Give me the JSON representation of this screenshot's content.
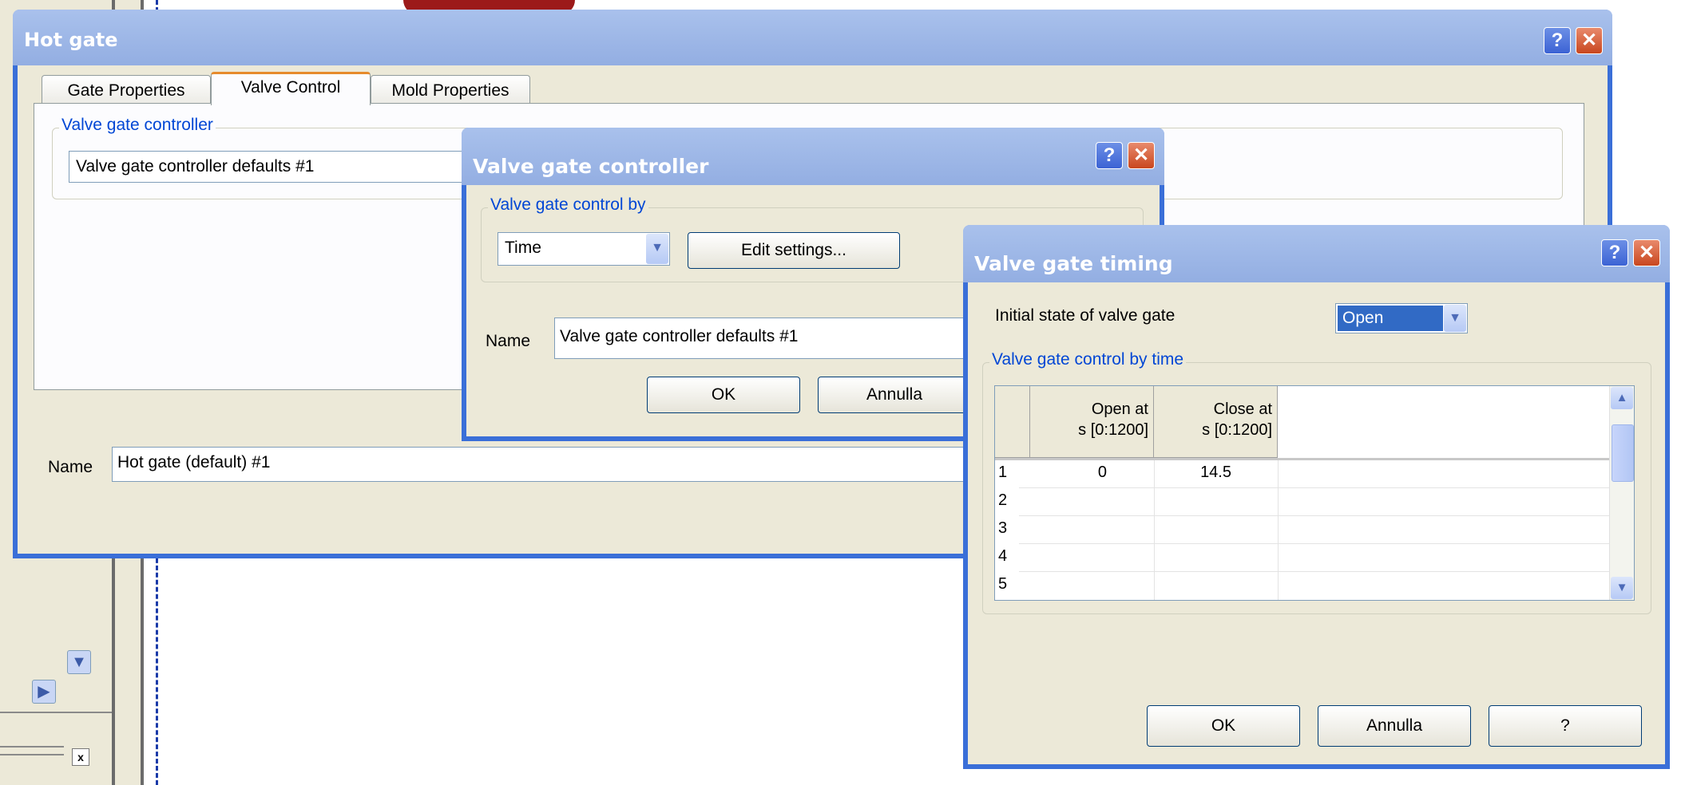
{
  "hot_gate": {
    "title": "Hot gate",
    "tabs": [
      "Gate Properties",
      "Valve Control",
      "Mold Properties"
    ],
    "group_label": "Valve gate controller",
    "controller_value": "Valve gate controller defaults #1",
    "name_label": "Name",
    "name_value": "Hot gate (default) #1"
  },
  "valve_gate_controller": {
    "title": "Valve gate controller",
    "group_label": "Valve gate control by",
    "control_by_value": "Time",
    "edit_settings_label": "Edit settings...",
    "name_label": "Name",
    "name_value": "Valve gate controller defaults #1",
    "ok_label": "OK",
    "cancel_label": "Annulla"
  },
  "valve_gate_timing": {
    "title": "Valve gate timing",
    "initial_state_label": "Initial state of valve gate",
    "initial_state_value": "Open",
    "group_label": "Valve gate control by time",
    "columns": [
      {
        "line1": "Open at",
        "line2": "s [0:1200]"
      },
      {
        "line1": "Close at",
        "line2": "s [0:1200]"
      }
    ],
    "rows": [
      {
        "num": "1",
        "open": "0",
        "close": "14.5"
      },
      {
        "num": "2",
        "open": "",
        "close": ""
      },
      {
        "num": "3",
        "open": "",
        "close": ""
      },
      {
        "num": "4",
        "open": "",
        "close": ""
      },
      {
        "num": "5",
        "open": "",
        "close": ""
      }
    ],
    "ok_label": "OK",
    "cancel_label": "Annulla",
    "help_label": "?"
  },
  "title_buttons": {
    "help": "?",
    "close": "✕"
  },
  "icons": {
    "dropdown": "▼",
    "scroll_up": "▲",
    "scroll_down": "▼",
    "scroll_right": "▶",
    "close_small": "x"
  },
  "colors": {
    "xp_blue": "#3a6fd8",
    "legend_blue": "#0046d5",
    "face": "#ece9d8",
    "tab_highlight": "#e68b2c",
    "close_red": "#c9471f"
  }
}
